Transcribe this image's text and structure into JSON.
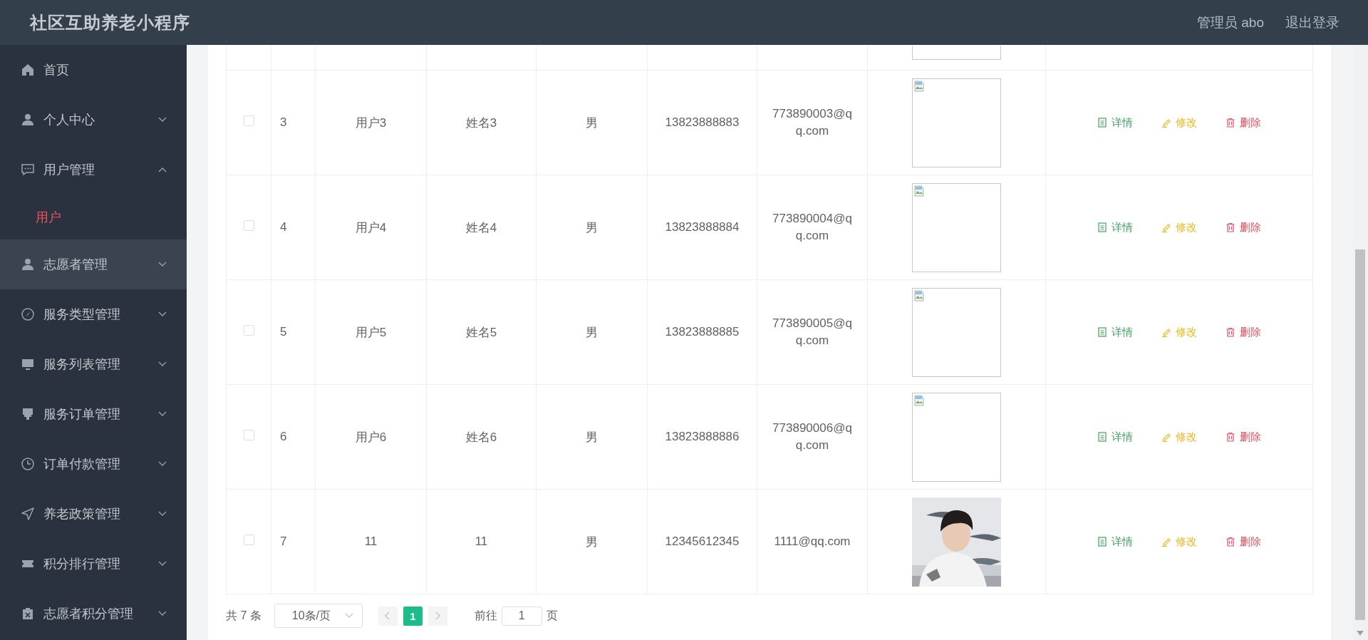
{
  "header": {
    "title": "社区互助养老小程序",
    "user": "管理员 abo",
    "logout": "退出登录"
  },
  "sidebar": {
    "items": [
      {
        "label": "首页",
        "kind": "home",
        "highlighted": false,
        "has_children": false
      },
      {
        "label": "个人中心",
        "kind": "user",
        "expanded": false,
        "highlighted": false,
        "has_children": true
      },
      {
        "label": "用户管理",
        "kind": "chat",
        "expanded": true,
        "highlighted": false,
        "has_children": true,
        "children": [
          {
            "label": "用户",
            "selected": true
          }
        ]
      },
      {
        "label": "志愿者管理",
        "kind": "user",
        "expanded": false,
        "highlighted": true,
        "has_children": true
      },
      {
        "label": "服务类型管理",
        "kind": "compass",
        "expanded": false,
        "highlighted": false,
        "has_children": true
      },
      {
        "label": "服务列表管理",
        "kind": "monitor",
        "expanded": false,
        "highlighted": false,
        "has_children": true
      },
      {
        "label": "服务订单管理",
        "kind": "stamp",
        "expanded": false,
        "highlighted": false,
        "has_children": true
      },
      {
        "label": "订单付款管理",
        "kind": "clock",
        "expanded": false,
        "highlighted": false,
        "has_children": true
      },
      {
        "label": "养老政策管理",
        "kind": "send",
        "expanded": false,
        "highlighted": false,
        "has_children": true
      },
      {
        "label": "积分排行管理",
        "kind": "ticket",
        "expanded": false,
        "highlighted": false,
        "has_children": true
      },
      {
        "label": "志愿者积分管理",
        "kind": "clipboard",
        "expanded": false,
        "highlighted": false,
        "has_children": true
      }
    ]
  },
  "table": {
    "rows": [
      {
        "checked": false,
        "index": "3",
        "account": "用户3",
        "name": "姓名3",
        "gender": "男",
        "phone": "13823888883",
        "email": "773890003@qq.com",
        "avatar": {
          "kind": "broken"
        },
        "actions": [
          {
            "kind": "detail",
            "label": "详情"
          },
          {
            "kind": "edit",
            "label": "修改"
          },
          {
            "kind": "delete",
            "label": "删除"
          }
        ]
      },
      {
        "checked": false,
        "index": "4",
        "account": "用户4",
        "name": "姓名4",
        "gender": "男",
        "phone": "13823888884",
        "email": "773890004@qq.com",
        "avatar": {
          "kind": "broken"
        },
        "actions": [
          {
            "kind": "detail",
            "label": "详情"
          },
          {
            "kind": "edit",
            "label": "修改"
          },
          {
            "kind": "delete",
            "label": "删除"
          }
        ]
      },
      {
        "checked": false,
        "index": "5",
        "account": "用户5",
        "name": "姓名5",
        "gender": "男",
        "phone": "13823888885",
        "email": "773890005@qq.com",
        "avatar": {
          "kind": "broken"
        },
        "actions": [
          {
            "kind": "detail",
            "label": "详情"
          },
          {
            "kind": "edit",
            "label": "修改"
          },
          {
            "kind": "delete",
            "label": "删除"
          }
        ]
      },
      {
        "checked": false,
        "index": "6",
        "account": "用户6",
        "name": "姓名6",
        "gender": "男",
        "phone": "13823888886",
        "email": "773890006@qq.com",
        "avatar": {
          "kind": "broken"
        },
        "actions": [
          {
            "kind": "detail",
            "label": "详情"
          },
          {
            "kind": "edit",
            "label": "修改"
          },
          {
            "kind": "delete",
            "label": "删除"
          }
        ]
      },
      {
        "checked": false,
        "index": "7",
        "account": "11",
        "name": "11",
        "gender": "男",
        "phone": "12345612345",
        "email": "1111@qq.com",
        "actions": [
          {
            "kind": "detail",
            "label": "详情"
          },
          {
            "kind": "edit",
            "label": "修改"
          },
          {
            "kind": "delete",
            "label": "删除"
          }
        ]
      }
    ]
  },
  "pagination": {
    "total": "共 7 条",
    "page_size": "10条/页",
    "pages": [
      {
        "label": "1",
        "selected": true
      }
    ],
    "goto_label": "前往",
    "goto_value": "1",
    "goto_suffix": "页"
  }
}
